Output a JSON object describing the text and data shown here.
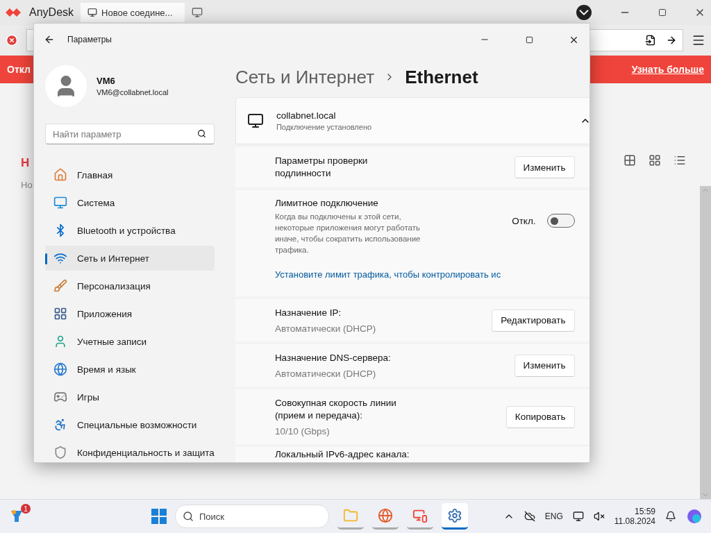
{
  "anydesk": {
    "app_name": "AnyDesk",
    "tab_title": "Новое соедине...",
    "banner_text": "Откл",
    "banner_link": "Узнать больше",
    "heading": "Н",
    "subtab": "Но"
  },
  "settings": {
    "title": "Параметры",
    "user": {
      "name": "VM6",
      "email": "VM6@collabnet.local"
    },
    "search": {
      "placeholder": "Найти параметр"
    },
    "nav": [
      {
        "label": "Главная",
        "selected": false
      },
      {
        "label": "Система",
        "selected": false
      },
      {
        "label": "Bluetooth и устройства",
        "selected": false
      },
      {
        "label": "Сеть и Интернет",
        "selected": true
      },
      {
        "label": "Персонализация",
        "selected": false
      },
      {
        "label": "Приложения",
        "selected": false
      },
      {
        "label": "Учетные записи",
        "selected": false
      },
      {
        "label": "Время и язык",
        "selected": false
      },
      {
        "label": "Игры",
        "selected": false
      },
      {
        "label": "Специальные возможности",
        "selected": false
      },
      {
        "label": "Конфиденциальность и защита",
        "selected": false
      }
    ],
    "breadcrumb": {
      "parent": "Сеть и Интернет",
      "current": "Ethernet"
    },
    "connection": {
      "name": "collabnet.local",
      "status": "Подключение установлено",
      "expanded": true
    },
    "rows": [
      {
        "kind": "button",
        "label": "Параметры проверки подлинности",
        "button": "Изменить"
      },
      {
        "kind": "toggle",
        "label": "Лимитное подключение",
        "description": "Когда вы подключены к этой сети, некоторые приложения могут работать иначе, чтобы сократить использование трафика.",
        "state_label": "Откл.",
        "on": false,
        "link": "Установите лимит трафика, чтобы контролировать ис"
      },
      {
        "kind": "button",
        "label": "Назначение IP:",
        "value": "Автоматически (DHCP)",
        "button": "Редактировать"
      },
      {
        "kind": "button",
        "label": "Назначение DNS-сервера:",
        "value": "Автоматически (DHCP)",
        "button": "Изменить"
      },
      {
        "kind": "button",
        "label": "Совокупная скорость линии (прием и передача):",
        "value": "10/10 (Gbps)",
        "button": "Копировать"
      },
      {
        "kind": "label",
        "label": "Локальный IPv6-адрес канала:"
      }
    ]
  },
  "taskbar": {
    "badge": "1",
    "search_placeholder": "Поиск",
    "apps": [
      {
        "selected": false
      },
      {
        "selected": false
      },
      {
        "selected": false
      },
      {
        "selected": true
      }
    ],
    "language": "ENG",
    "time": "15:59",
    "date": "11.08.2024"
  }
}
